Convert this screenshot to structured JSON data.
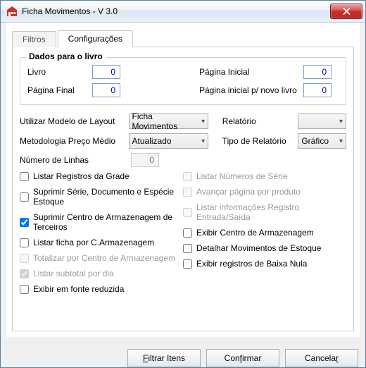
{
  "window": {
    "title": "Ficha Movimentos - V 3.0"
  },
  "tabs": {
    "filtros": "Filtros",
    "config": "Configurações"
  },
  "group": {
    "legend": "Dados para o livro",
    "livro_label": "Livro",
    "livro_value": "0",
    "pagina_inicial_label": "Página Inicial",
    "pagina_inicial_value": "0",
    "pagina_final_label": "Página Final",
    "pagina_final_value": "0",
    "pagina_novo_livro_label": "Página inicial p/ novo livro",
    "pagina_novo_livro_value": "0"
  },
  "form": {
    "modelo_label": "Utilizar Modelo de Layout",
    "modelo_value": "Ficha Movimentos",
    "relatorio_label": "Relatório",
    "relatorio_value": "",
    "metodo_label": "Metodologia Preço Médio",
    "metodo_value": "Atualizado",
    "tipo_label": "Tipo de Relatório",
    "tipo_value": "Gráfico",
    "linhas_label": "Número de Linhas",
    "linhas_value": "0"
  },
  "checks": {
    "left": [
      {
        "label": "Listar Registros da Grade",
        "checked": false,
        "disabled": false
      },
      {
        "label": "Suprimir Série, Documento e Espécie Estoque",
        "checked": false,
        "disabled": false
      },
      {
        "label": "Suprimir Centro de Armazenagem de Terceiros",
        "checked": true,
        "disabled": false
      },
      {
        "label": "Listar ficha por C.Armazenagem",
        "checked": false,
        "disabled": false
      },
      {
        "label": "Totalizar por Centro de Armazenagem",
        "checked": false,
        "disabled": true
      },
      {
        "label": "Listar subtotal por dia",
        "checked": true,
        "disabled": true
      },
      {
        "label": "Exibir em fonte reduzida",
        "checked": false,
        "disabled": false
      }
    ],
    "right": [
      {
        "label": "Listar Números de Série",
        "checked": false,
        "disabled": true
      },
      {
        "label": "Avançar página por produto",
        "checked": false,
        "disabled": true
      },
      {
        "label": "Listar informações Registro Entrada/Saída",
        "checked": false,
        "disabled": true
      },
      {
        "label": "Exibir Centro de Armazenagem",
        "checked": false,
        "disabled": false
      },
      {
        "label": "Detalhar Movimentos de Estoque",
        "checked": false,
        "disabled": false
      },
      {
        "label": "Exibir registros de Baixa Nula",
        "checked": false,
        "disabled": false
      }
    ]
  },
  "buttons": {
    "filtrar": "Filtrar Itens",
    "confirmar": "Confirmar",
    "cancelar": "Cancelar"
  }
}
